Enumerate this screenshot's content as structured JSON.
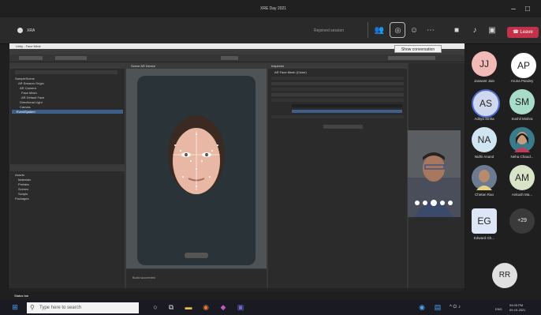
{
  "meeting": {
    "title": "XRE Day 2021",
    "logo": "XRA"
  },
  "teams_toolbar": {
    "meeting_timer": "Rejoined session",
    "leave_label": "Leave",
    "tooltip": "Show conversation"
  },
  "unity": {
    "window_title": "Unity - Face Mesh",
    "scene_tab": "Scene  AR Device",
    "inspector_tab": "Inspector",
    "inspector_object": "AR Face Mesh (Clone)",
    "hierarchy_items": [
      "SampleScene",
      "AR Session Origin",
      "AR Camera",
      "Face Mesh",
      "AR Default Face",
      "Directional Light",
      "Canvas",
      "EventSystem"
    ],
    "project_items": [
      "Assets",
      "Materials",
      "Prefabs",
      "Scenes",
      "Scripts",
      "Packages"
    ],
    "console_text": "Build succeeded"
  },
  "participants": [
    {
      "initials": "JJ",
      "name": "Jaswant Jain",
      "color": "#f2b9b6"
    },
    {
      "initials": "AP",
      "name": "Aruna Pandey",
      "color": "#ffffff"
    },
    {
      "initials": "AS",
      "name": "Aditya Sinha",
      "color": "#cfd8ee"
    },
    {
      "initials": "SM",
      "name": "Sushil Mishra",
      "color": "#a8dcc8"
    },
    {
      "initials": "NA",
      "name": "Nidhi Anand",
      "color": "#cfe6f2"
    },
    {
      "initials": "",
      "name": "Neha Chaud...",
      "color": "#3a7a8a"
    },
    {
      "initials": "",
      "name": "Chetan Rao",
      "color": "#6b7c92"
    },
    {
      "initials": "AM",
      "name": "Ankush Ma...",
      "color": "#d8e4c8"
    },
    {
      "initials": "EG",
      "name": "Edward Gh...",
      "color": "#dce6f5"
    },
    {
      "initials": "+29",
      "name": "",
      "color": "#3a3a3a"
    },
    {
      "initials": "RR",
      "name": "",
      "color": "#e0e0e0"
    }
  ],
  "taskbar": {
    "search_placeholder": "Type here to search",
    "time": "04:05 PM",
    "date": "09-10-2021",
    "lang": "ENG",
    "status_label": "Status bar"
  },
  "colors": {
    "leave": "#c4314b",
    "face": "#e8b8a4"
  }
}
